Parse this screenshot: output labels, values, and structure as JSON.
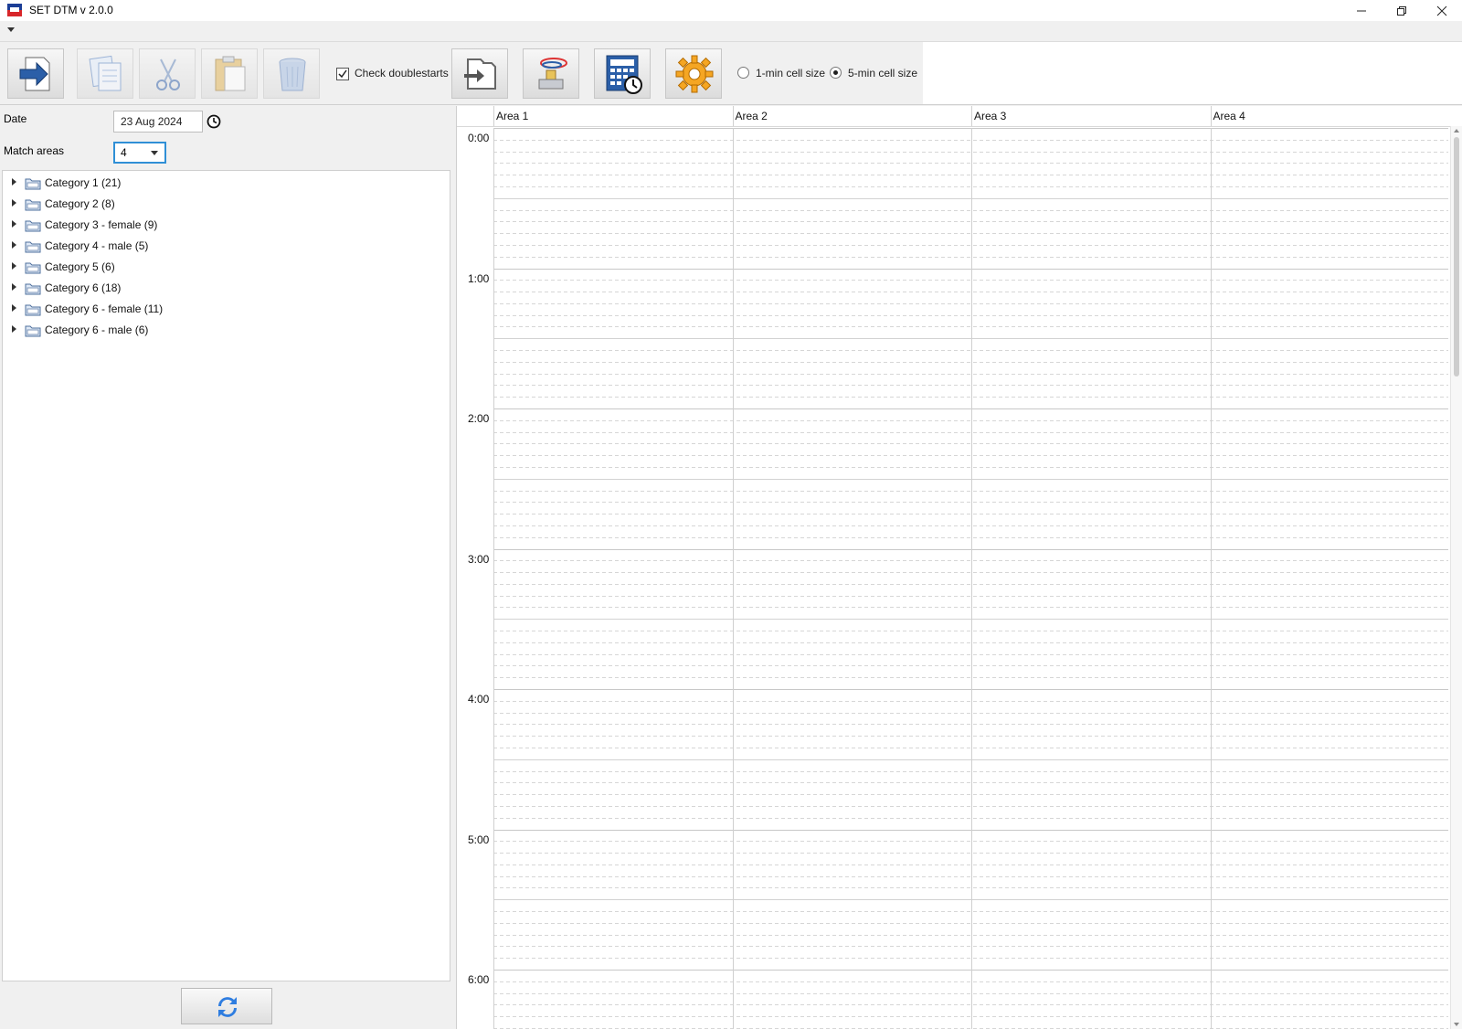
{
  "window": {
    "title": "SET DTM v 2.0.0",
    "controls": [
      "minimize-icon",
      "maximize-icon",
      "close-icon"
    ]
  },
  "toolbar": {
    "buttons": [
      "export-arrow-icon",
      "copy-icon",
      "cut-icon",
      "paste-icon",
      "delete-icon",
      "swap-icon",
      "stamp-icon",
      "calendar-clock-icon",
      "settings-gear-icon"
    ],
    "check_doublestarts_label": "Check doublestarts",
    "check_doublestarts": true,
    "cell_size_1_label": "1-min cell size",
    "cell_size_5_label": "5-min cell size",
    "cell_size_selected": "5-min"
  },
  "filters": {
    "date_label": "Date",
    "date_value": "23 Aug 2024",
    "match_areas_label": "Match areas",
    "match_areas_value": "4"
  },
  "categories": [
    "Category 1 (21)",
    "Category 2 (8)",
    "Category 3 - female (9)",
    "Category 4 - male (5)",
    "Category 5 (6)",
    "Category 6 (18)",
    "Category 6 - female (11)",
    "Category 6 - male (6)"
  ],
  "schedule": {
    "areas": [
      "Area 1",
      "Area 2",
      "Area 3",
      "Area 4"
    ],
    "times": [
      "0:00",
      "1:00",
      "2:00",
      "3:00",
      "4:00",
      "5:00",
      "6:00"
    ]
  },
  "colors": {
    "accent_blue": "#2f8fd6",
    "gear_orange": "#f5a623",
    "grid_line": "#cfcfcf"
  }
}
